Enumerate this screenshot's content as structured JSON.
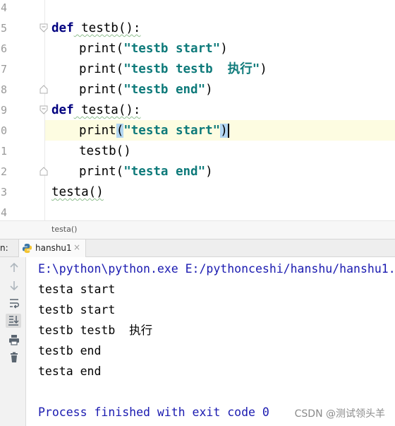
{
  "editor": {
    "lines": [
      {
        "num": "4"
      },
      {
        "num": "5"
      },
      {
        "num": "6"
      },
      {
        "num": "7"
      },
      {
        "num": "8"
      },
      {
        "num": "9"
      },
      {
        "num": "0"
      },
      {
        "num": "1"
      },
      {
        "num": "2"
      },
      {
        "num": "3"
      },
      {
        "num": "4"
      }
    ],
    "code": {
      "l5_kw": "def",
      "l5_rest": " testb():",
      "l6_fn": "print(",
      "l6_str": "\"testb start\"",
      "l6_end": ")",
      "l7_fn": "print(",
      "l7_str": "\"testb testb  执行\"",
      "l7_end": ")",
      "l8_fn": "print(",
      "l8_str": "\"testb end\"",
      "l8_end": ")",
      "l9_kw": "def",
      "l9_rest": " testa():",
      "l10_fn": "print",
      "l10_open": "(",
      "l10_str": "\"testa start\"",
      "l10_close": ")",
      "l11": "testb()",
      "l12_fn": "print(",
      "l12_str": "\"testa end\"",
      "l12_end": ")",
      "l13": "testa()"
    },
    "breadcrumb": "testa()"
  },
  "run": {
    "label": "n:",
    "tab_label": "hanshu1",
    "tab_close": "×",
    "icons": [
      "arrow-up-icon",
      "arrow-down-icon",
      "soft-wrap-icon",
      "scroll-to-end-icon",
      "print-icon",
      "trash-icon"
    ]
  },
  "console": {
    "command": "E:\\python\\python.exe E:/pythonceshi/hanshu/hanshu1.",
    "output": [
      "testa start",
      "testb start",
      "testb testb  执行",
      "testb end",
      "testa end"
    ],
    "exit": "Process finished with exit code 0"
  },
  "watermark": "CSDN @测试领头羊",
  "colors": {
    "keyword": "#000080",
    "string": "#0e7a7a",
    "current_line": "#fdfce1",
    "brace_match": "#b3d7f2",
    "console_meta": "#1a1ab0"
  }
}
